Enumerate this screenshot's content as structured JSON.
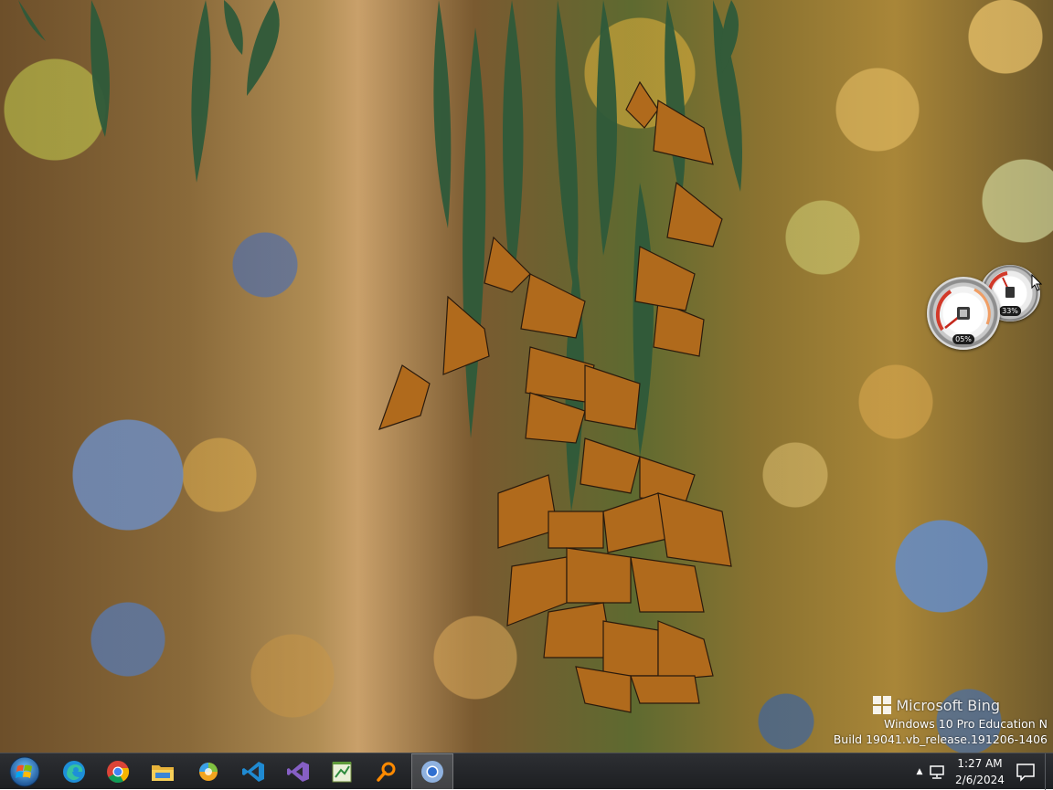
{
  "wallpaper": {
    "watermark_brand": "Microsoft Bing",
    "os_edition": "Windows 10 Pro Education N",
    "os_build": "Build 19041.vb_release.191206-1406"
  },
  "gadget": {
    "cpu_percent": "05%",
    "memory_percent": "33%",
    "cpu_value": 0.05,
    "memory_value": 0.33
  },
  "taskbar": {
    "items": [
      {
        "name": "start-button",
        "icon": "windows-orb-icon"
      },
      {
        "name": "edge",
        "icon": "edge-icon"
      },
      {
        "name": "chrome",
        "icon": "chrome-icon"
      },
      {
        "name": "file-explorer",
        "icon": "folder-icon"
      },
      {
        "name": "app-orb",
        "icon": "colorful-orb-icon"
      },
      {
        "name": "vscode",
        "icon": "vscode-icon"
      },
      {
        "name": "visual-studio",
        "icon": "visual-studio-icon"
      },
      {
        "name": "notepad",
        "icon": "notepad-icon"
      },
      {
        "name": "search-tool",
        "icon": "magnifier-icon"
      },
      {
        "name": "chrome-active",
        "icon": "chrome-icon"
      }
    ],
    "clock_time": "1:27 AM",
    "clock_date": "2/6/2024",
    "colors": {
      "taskbar": "#1d1f22",
      "accent": "#ff8a00"
    }
  }
}
